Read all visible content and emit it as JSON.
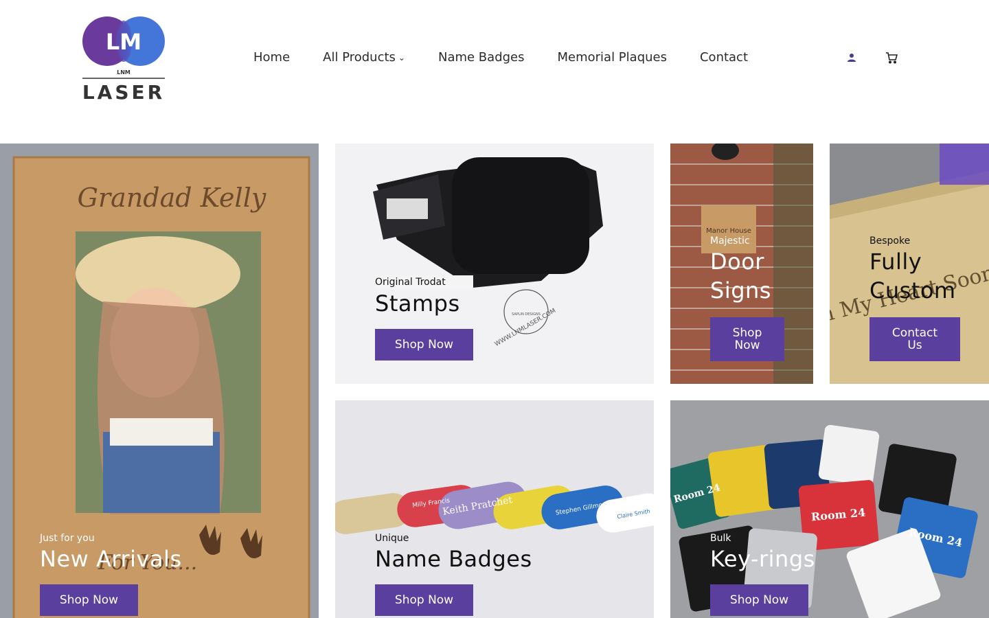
{
  "brand": {
    "logo_letters": "LM",
    "logo_small": "LNM",
    "logo_word": "LASER"
  },
  "nav": {
    "items": [
      "Home",
      "All Products",
      "Name Badges",
      "Memorial Plaques",
      "Contact"
    ],
    "dropdown_chevron": "⌄"
  },
  "icons": {
    "account": "user-icon",
    "cart": "cart-icon"
  },
  "tiles": {
    "new_arrivals": {
      "eyebrow": "Just for you",
      "title": "New Arrivals",
      "button": "Shop Now",
      "frame_text": "Grandad Kelly",
      "frame_footer": "For You..."
    },
    "stamps": {
      "eyebrow": "Original Trodat",
      "title": "Stamps",
      "button": "Shop Now",
      "stamp_print": "WWW.LNMLASER.COM",
      "stamp_brand": "SAPLIN DESIGNS"
    },
    "door_signs": {
      "eyebrow": "Majestic",
      "title_line1": "Door",
      "title_line2": "Signs",
      "button_line1": "Shop",
      "button_line2": "Now",
      "plaque_text": "Manor House"
    },
    "custom": {
      "eyebrow": "Bespoke",
      "title_line1": "Fully",
      "title_line2": "Custom",
      "button_line1": "Contact",
      "button_line2": "Us",
      "plaque_text": "In My Heart Soon"
    },
    "name_badges": {
      "eyebrow": "Unique",
      "title": "Name Badges",
      "button": "Shop Now",
      "badges": [
        "Keith Pratchet",
        "Milly Francis",
        "Stephen Gillmore",
        "Claire Smith"
      ]
    },
    "keyrings": {
      "eyebrow": "Bulk",
      "title": "Key-rings",
      "button": "Shop Now",
      "tag_text": "Room 24"
    }
  },
  "colors": {
    "accent": "#5b3f9e",
    "logo_purple": "#6a3a9c",
    "logo_blue": "#3a6fd8"
  }
}
